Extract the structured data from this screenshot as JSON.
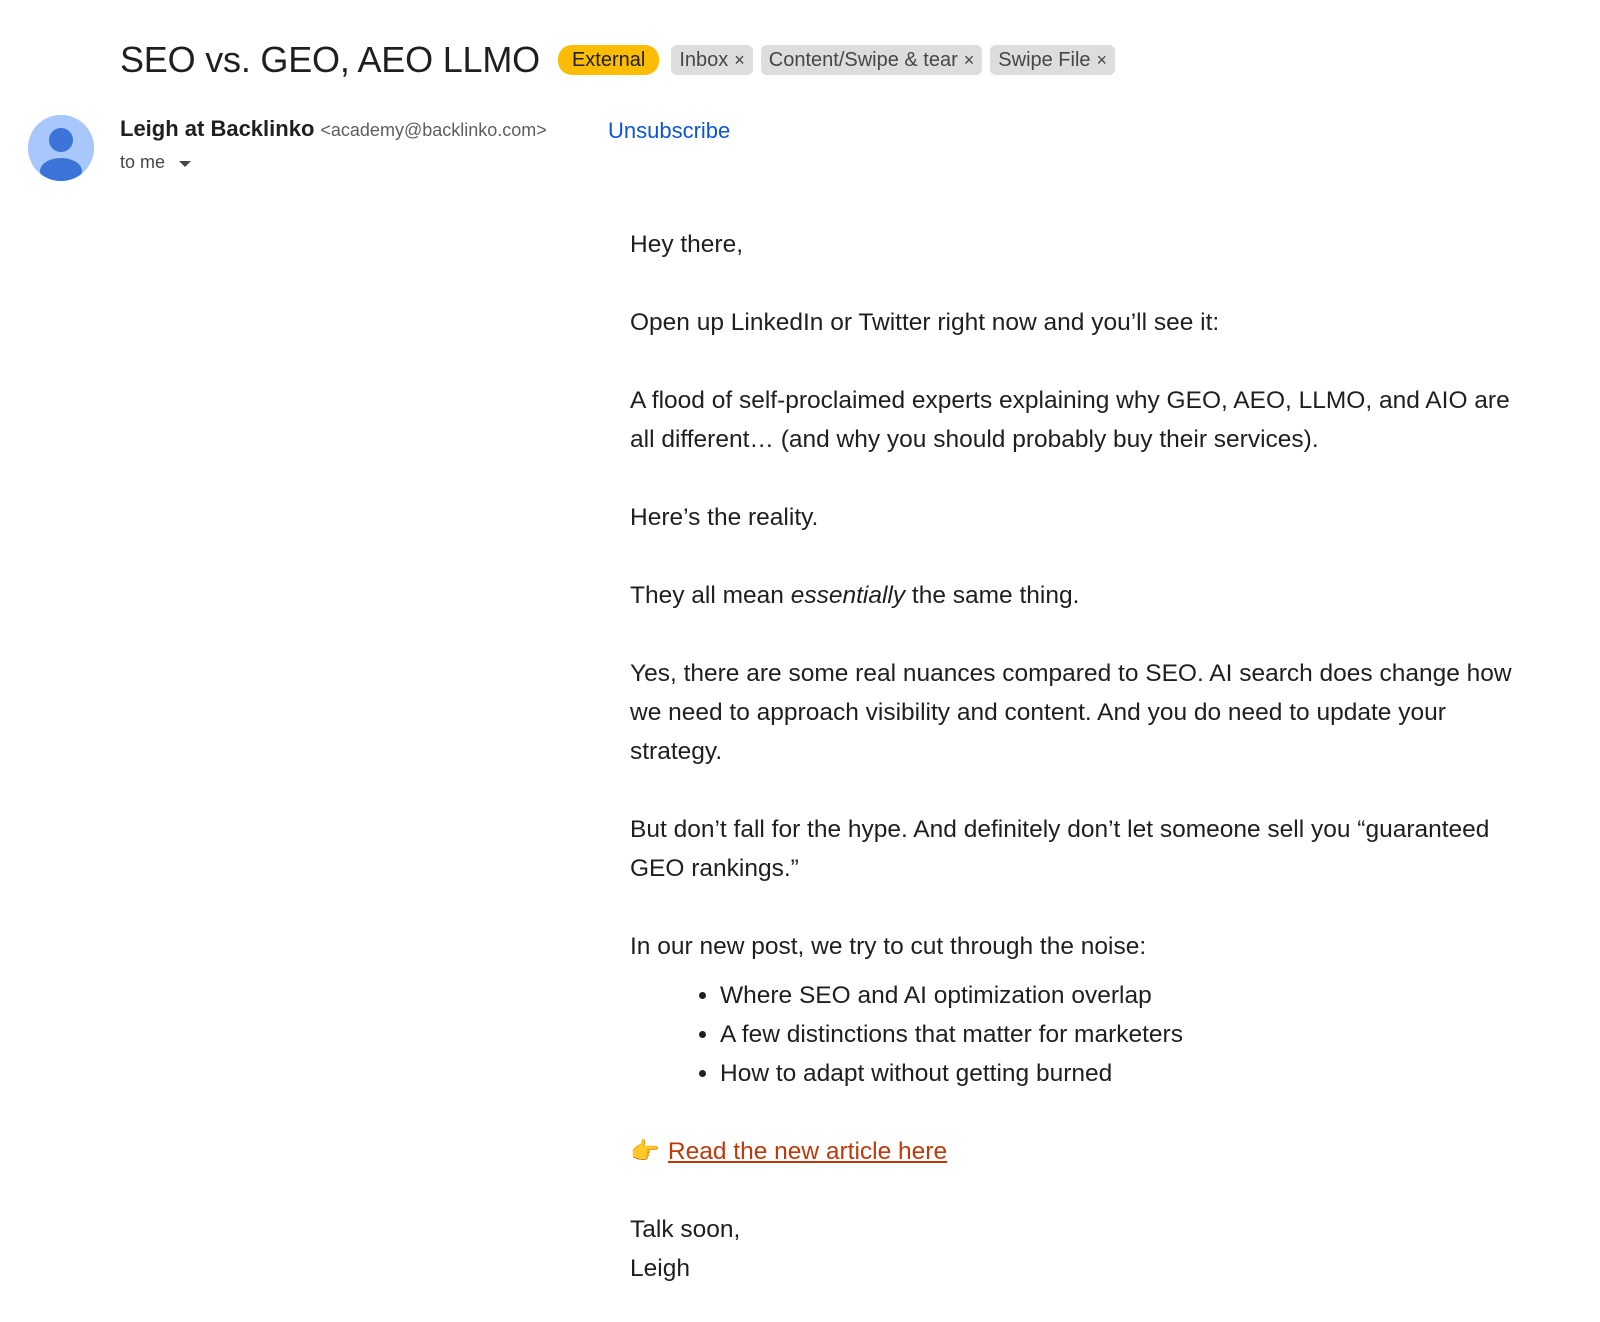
{
  "email": {
    "subject": "SEO vs. GEO, AEO LLMO",
    "external_badge": "External",
    "labels": [
      {
        "text": "Inbox",
        "remove": "×"
      },
      {
        "text": "Content/Swipe & tear",
        "remove": "×"
      },
      {
        "text": "Swipe File",
        "remove": "×"
      }
    ],
    "sender": {
      "name": "Leigh at Backlinko",
      "email": "<academy@backlinko.com>",
      "avatar_icon": "person-avatar-icon"
    },
    "unsubscribe_label": "Unsubscribe",
    "recipient_label": "to me",
    "body": {
      "greeting": "Hey there,",
      "p1": "Open up LinkedIn or Twitter right now and you’ll see it:",
      "p2": "A flood of self-proclaimed experts explaining why GEO, AEO, LLMO, and AIO are all different… (and why you should probably buy their services).",
      "p3": "Here’s the reality.",
      "p4_before": "They all mean ",
      "p4_em": "essentially",
      "p4_after": " the same thing.",
      "p5": "Yes, there are some real nuances compared to SEO. AI search does change how we need to approach visibility and content. And you do need to update your strategy.",
      "p6": "But don’t fall for the hype. And definitely don’t let someone sell you “guaranteed GEO rankings.”",
      "p7": "In our new post, we try to cut through the noise:",
      "bullets": [
        "Where SEO and AI optimization overlap",
        "A few distinctions that matter for marketers",
        "How to adapt without getting burned"
      ],
      "cta_emoji": "👉",
      "cta_link": "Read the new article here",
      "signoff": "Talk soon,",
      "signature": "Leigh"
    }
  },
  "colors": {
    "external_badge": "#fbbc04",
    "label_chip": "#dddddd",
    "link_blue": "#0b57d0",
    "cta_link": "#c0390b",
    "avatar_bg": "#a8c7fa",
    "avatar_fg": "#3b73d9"
  }
}
